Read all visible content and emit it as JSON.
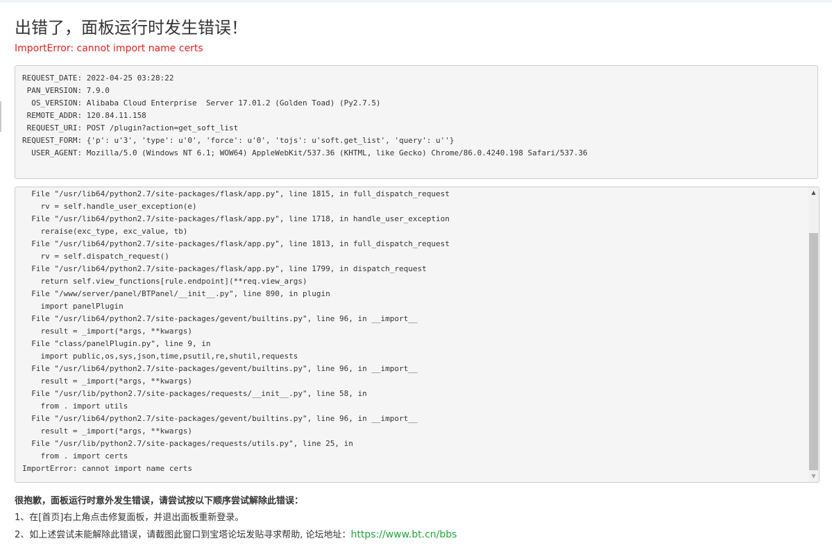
{
  "title": "出错了，面板运行时发生错误！",
  "error_message": "ImportError: cannot import name certs",
  "request_info": [
    "REQUEST_DATE: 2022-04-25 03:28:22",
    " PAN_VERSION: 7.9.0",
    "  OS_VERSION: Alibaba Cloud Enterprise  Server 17.01.2 (Golden Toad) (Py2.7.5)",
    " REMOTE_ADDR: 120.84.11.158",
    " REQUEST_URI: POST /plugin?action=get_soft_list",
    "REQUEST_FORM: {'p': u'3', 'type': u'0', 'force': u'0', 'tojs': u'soft.get_list', 'query': u''}",
    "  USER_AGENT: Mozilla/5.0 (Windows NT 6.1; WOW64) AppleWebKit/537.36 (KHTML, like Gecko) Chrome/86.0.4240.198 Safari/537.36"
  ],
  "traceback": [
    "  File \"/usr/lib64/python2.7/site-packages/flask/app.py\", line 1815, in full_dispatch_request",
    "    rv = self.handle_user_exception(e)",
    "  File \"/usr/lib64/python2.7/site-packages/flask/app.py\", line 1718, in handle_user_exception",
    "    reraise(exc_type, exc_value, tb)",
    "  File \"/usr/lib64/python2.7/site-packages/flask/app.py\", line 1813, in full_dispatch_request",
    "    rv = self.dispatch_request()",
    "  File \"/usr/lib64/python2.7/site-packages/flask/app.py\", line 1799, in dispatch_request",
    "    return self.view_functions[rule.endpoint](**req.view_args)",
    "  File \"/www/server/panel/BTPanel/__init__.py\", line 890, in plugin",
    "    import panelPlugin",
    "  File \"/usr/lib64/python2.7/site-packages/gevent/builtins.py\", line 96, in __import__",
    "    result = _import(*args, **kwargs)",
    "  File \"class/panelPlugin.py\", line 9, in",
    "    import public,os,sys,json,time,psutil,re,shutil,requests",
    "  File \"/usr/lib64/python2.7/site-packages/gevent/builtins.py\", line 96, in __import__",
    "    result = _import(*args, **kwargs)",
    "  File \"/usr/lib/python2.7/site-packages/requests/__init__.py\", line 58, in",
    "    from . import utils",
    "  File \"/usr/lib64/python2.7/site-packages/gevent/builtins.py\", line 96, in __import__",
    "    result = _import(*args, **kwargs)",
    "  File \"/usr/lib/python2.7/site-packages/requests/utils.py\", line 25, in",
    "    from . import certs",
    "ImportError: cannot import name certs"
  ],
  "scrollbar": {
    "up_arrow": "▲",
    "down_arrow": "▼",
    "up_icon": "triangle-up-icon",
    "down_icon": "triangle-down-icon"
  },
  "help": {
    "heading": "很抱歉，面板运行时意外发生错误，请尝试按以下顺序尝试解除此错误：",
    "step1": "1、在[首页]右上角点击修复面板，并退出面板重新登录。",
    "step2_prefix": "2、如上述尝试未能解除此错误，请截图此窗口到宝塔论坛发贴寻求帮助, 论坛地址：",
    "forum_link": "https://www.bt.cn/bbs"
  },
  "colors": {
    "error": "#e02020",
    "link": "#20a53a",
    "box_background": "#f5f5f5",
    "box_border": "#cccccc"
  }
}
